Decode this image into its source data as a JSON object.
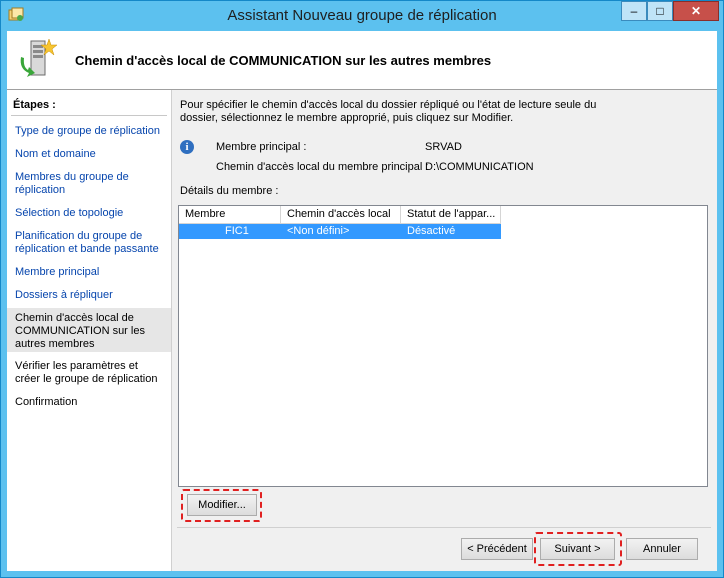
{
  "window": {
    "title": "Assistant Nouveau groupe de réplication"
  },
  "controls": {
    "minimize": "–",
    "maximize": "□",
    "close": "✕"
  },
  "header": {
    "title": "Chemin d'accès local de COMMUNICATION sur les autres membres",
    "icon": "server-wizard-icon"
  },
  "sidebar": {
    "label": "Étapes :",
    "steps": [
      "Type de groupe de réplication",
      "Nom et domaine",
      "Membres du groupe de réplication",
      "Sélection de topologie",
      "Planification du groupe de réplication et bande passante",
      "Membre principal",
      "Dossiers à répliquer",
      "Chemin d'accès local de COMMUNICATION sur les autres membres",
      "Vérifier les paramètres et créer le groupe de réplication",
      "Confirmation"
    ]
  },
  "main": {
    "instructions": "Pour spécifier le chemin d'accès local du dossier répliqué ou l'état de lecture seule du dossier, sélectionnez le membre approprié, puis cliquez sur Modifier.",
    "primary_member_label": "Membre principal :",
    "primary_member_value": "SRVAD",
    "local_path_label": "Chemin d'accès local du membre principal :",
    "local_path_value": "D:\\COMMUNICATION",
    "details_label": "Détails du membre :",
    "table": {
      "columns": [
        "Membre",
        "Chemin d'accès local",
        "Statut de l'appar..."
      ],
      "rows": [
        {
          "member": "FIC1",
          "path": "<Non défini>",
          "status": "Désactivé"
        }
      ]
    },
    "modify_button": "Modifier..."
  },
  "footer": {
    "previous": "< Précédent",
    "next": "Suivant >",
    "cancel": "Annuler"
  },
  "colors": {
    "accent": "#5cc1ef",
    "selection": "#3399ff",
    "highlight": "#e02020",
    "link": "#0645ad"
  }
}
